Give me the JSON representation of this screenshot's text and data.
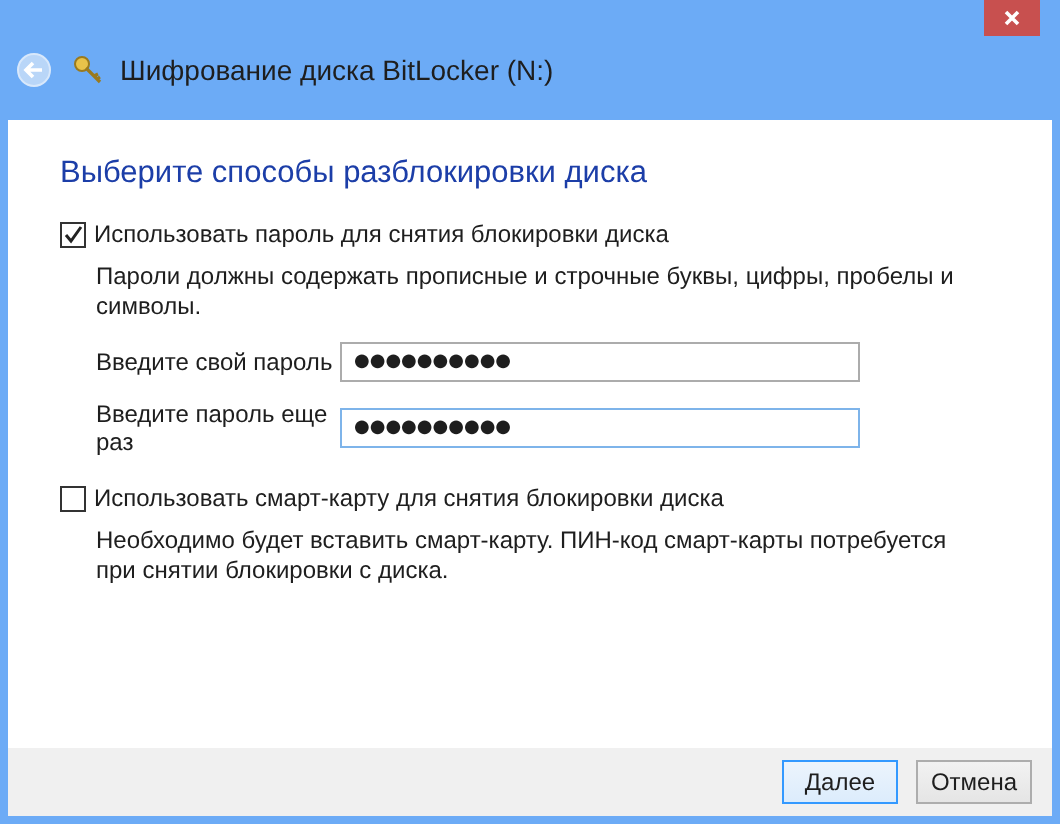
{
  "window": {
    "title": "Шифрование диска BitLocker (N:)"
  },
  "heading": "Выберите способы разблокировки диска",
  "options": [
    {
      "label": "Использовать пароль для снятия блокировки диска",
      "checked": true,
      "description": "Пароли должны содержать прописные и строчные буквы, цифры, пробелы и символы.",
      "fields": [
        {
          "label": "Введите свой пароль",
          "value": "●●●●●●●●●●",
          "focused": false
        },
        {
          "label": "Введите пароль еще раз",
          "value": "●●●●●●●●●●",
          "focused": true
        }
      ]
    },
    {
      "label": "Использовать смарт-карту для снятия блокировки диска",
      "checked": false,
      "description": "Необходимо будет вставить смарт-карту. ПИН-код смарт-карты потребуется при снятии блокировки с диска."
    }
  ],
  "buttons": [
    {
      "label": "Далее",
      "default": true
    },
    {
      "label": "Отмена",
      "default": false
    }
  ]
}
